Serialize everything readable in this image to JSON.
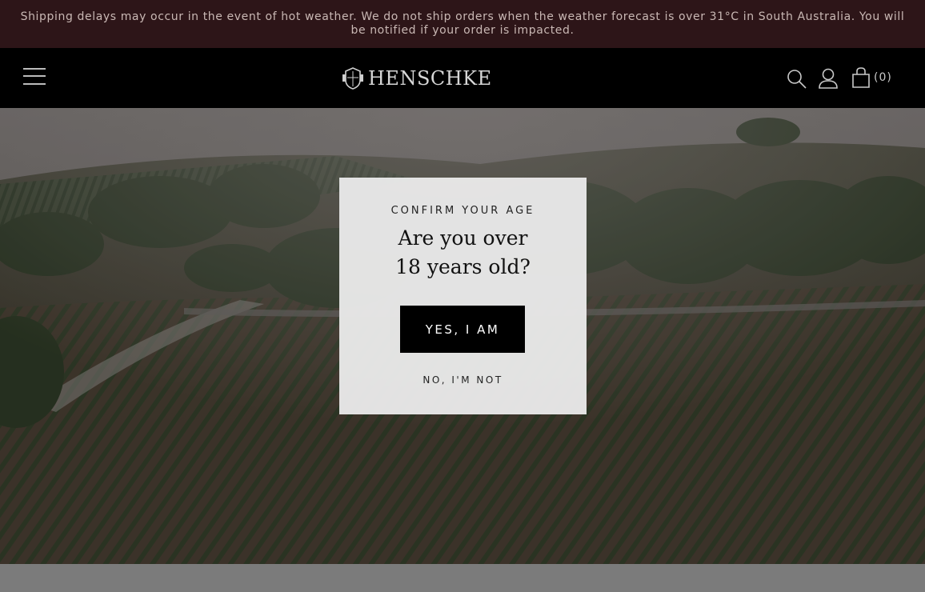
{
  "announcement": {
    "text": "Shipping delays may occur in the event of hot weather. We do not ship orders when the weather forecast is over 31°C in South Australia. You will be notified if your order is impacted."
  },
  "header": {
    "brand": "HENSCHKE",
    "cart_count": "(0)",
    "icons": [
      "menu-icon",
      "search-icon",
      "account-icon",
      "cart-icon"
    ]
  },
  "age_gate": {
    "eyebrow": "CONFIRM YOUR AGE",
    "question": "Are you over 18 years old?",
    "confirm_label": "YES, I AM",
    "deny_label": "NO, I'M NOT"
  },
  "colors": {
    "announcement_bg": "#2d1518",
    "header_bg": "#000000",
    "modal_bg": "#e8e8e8",
    "button_bg": "#000000"
  }
}
